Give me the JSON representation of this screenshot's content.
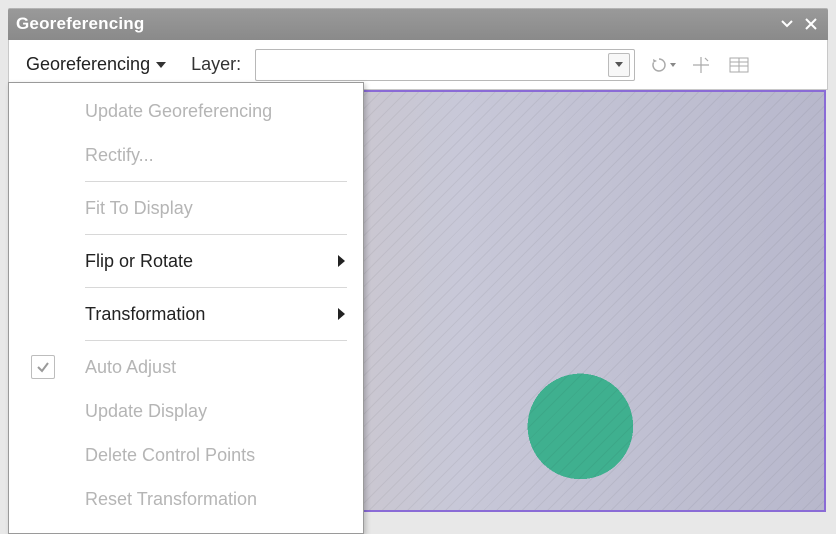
{
  "titlebar": {
    "title": "Georeferencing"
  },
  "toolbar": {
    "dropdown_label": "Georeferencing",
    "layer_label": "Layer:",
    "layer_value": ""
  },
  "menu": {
    "items": [
      {
        "label": "Update Georeferencing",
        "enabled": false,
        "submenu": false,
        "checked": false
      },
      {
        "label": "Rectify...",
        "enabled": false,
        "submenu": false,
        "checked": false
      },
      {
        "separator": true
      },
      {
        "label": "Fit To Display",
        "enabled": false,
        "submenu": false,
        "checked": false
      },
      {
        "separator": true
      },
      {
        "label": "Flip or Rotate",
        "enabled": true,
        "submenu": true,
        "checked": false
      },
      {
        "separator": true
      },
      {
        "label": "Transformation",
        "enabled": true,
        "submenu": true,
        "checked": false
      },
      {
        "separator": true
      },
      {
        "label": "Auto Adjust",
        "enabled": false,
        "submenu": false,
        "checked": true
      },
      {
        "label": "Update Display",
        "enabled": false,
        "submenu": false,
        "checked": false
      },
      {
        "label": "Delete Control Points",
        "enabled": false,
        "submenu": false,
        "checked": false
      },
      {
        "label": "Reset Transformation",
        "enabled": false,
        "submenu": false,
        "checked": false
      }
    ]
  },
  "icons": {
    "minimize": "minimize-arrow-icon",
    "close": "close-icon",
    "rotate_tool": "rotate-tool-icon",
    "add_point": "add-control-point-icon",
    "link_table": "link-table-icon"
  }
}
